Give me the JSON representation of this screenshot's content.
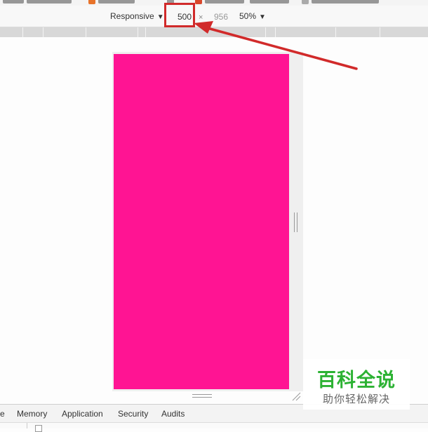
{
  "toolbar": {
    "device_label": "Responsive",
    "width_value": "500",
    "times_symbol": "×",
    "height_value": "956",
    "zoom_label": "50%",
    "caret": "▼"
  },
  "viewport": {
    "page_color": "#ff1493"
  },
  "bottom_tabs": [
    {
      "label": "e"
    },
    {
      "label": "Memory"
    },
    {
      "label": "Application"
    },
    {
      "label": "Security"
    },
    {
      "label": "Audits"
    }
  ],
  "watermark": {
    "title": "百科全说",
    "subtitle": "助你轻松解决"
  },
  "colors": {
    "annotation_red": "#d12a2a",
    "brand_green": "#2cb233"
  },
  "icons": {
    "resize_handle_right": "vertical-grip-icon",
    "resize_handle_bottom": "horizontal-grip-icon",
    "resize_corner": "corner-resize-icon"
  }
}
